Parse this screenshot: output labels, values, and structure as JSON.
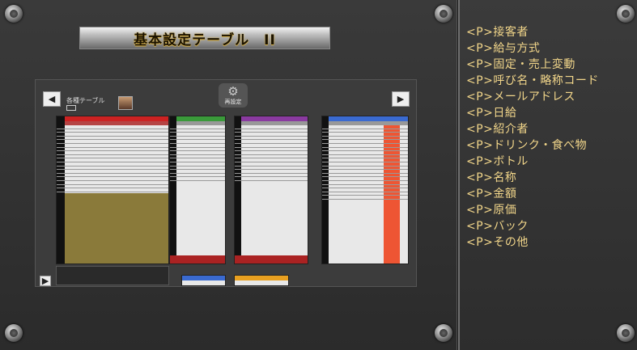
{
  "title": "基本設定テーブル　II",
  "screen": {
    "sub_label": "各種テーブル",
    "settings_label": "再設定",
    "nav_left": "◀",
    "nav_right": "▶",
    "nav_bottom": "▶"
  },
  "side_items": [
    "<P>接客者",
    "<P>給与方式",
    "<P>固定・売上変動",
    "<P>呼び名・略称コード",
    "<P>メールアドレス",
    "<P>日給",
    "<P>紹介者",
    "<P>ドリンク・食べ物",
    "<P>ボトル",
    "<P>名称",
    "<P>金額",
    "<P>原価",
    "<P>バック",
    "<P>その他"
  ],
  "colors": {
    "accent_text": "#f2d68a",
    "table_red_header": "#cc2222",
    "table_green_header": "#3a9a3a",
    "table_purple_header": "#8a3aa0",
    "table_blue_header": "#3a6ad0",
    "table_orange_col": "#ee5533",
    "olive_fill": "#8a7a3a"
  },
  "icons": {
    "settings": "gear-icon",
    "avatar": "avatar-photo"
  }
}
